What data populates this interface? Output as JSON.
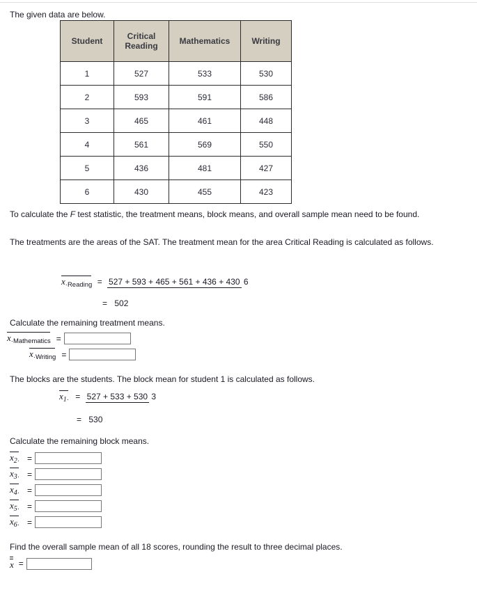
{
  "intro": {
    "text": "The given data are below."
  },
  "table": {
    "headers": [
      "Student",
      "Critical Reading",
      "Mathematics",
      "Writing"
    ],
    "header_lines": [
      [
        "Student"
      ],
      [
        "Critical",
        "Reading"
      ],
      [
        "Mathematics"
      ],
      [
        "Writing"
      ]
    ],
    "rows": [
      {
        "student": "1",
        "critical_reading": "527",
        "mathematics": "533",
        "writing": "530"
      },
      {
        "student": "2",
        "critical_reading": "593",
        "mathematics": "591",
        "writing": "586"
      },
      {
        "student": "3",
        "critical_reading": "465",
        "mathematics": "461",
        "writing": "448"
      },
      {
        "student": "4",
        "critical_reading": "561",
        "mathematics": "569",
        "writing": "550"
      },
      {
        "student": "5",
        "critical_reading": "436",
        "mathematics": "481",
        "writing": "427"
      },
      {
        "student": "6",
        "critical_reading": "430",
        "mathematics": "455",
        "writing": "423"
      }
    ]
  },
  "paragraphs": {
    "f_stat_pre": "To calculate the ",
    "f_stat_italic": "F",
    "f_stat_post": " test statistic, the treatment means, block means, and overall sample mean need to be found.",
    "treatments": "The treatments are the areas of the SAT. The treatment mean for the area Critical Reading is calculated as follows.",
    "calc_treatment_means": "Calculate the remaining treatment means.",
    "blocks": "The blocks are the students. The block mean for student 1 is calculated as follows.",
    "calc_block_means": "Calculate the remaining block means.",
    "overall": "Find the overall sample mean of all 18 scores, rounding the result to three decimal places."
  },
  "treatment_example": {
    "symbol": "x",
    "subscript": "·Reading",
    "equals": "=",
    "numerator": "527 + 593 + 465 + 561 + 436 + 430",
    "denominator": "6",
    "result_equals": "=",
    "result": "502"
  },
  "treatment_inputs": [
    {
      "symbol": "x",
      "subscript": "·Mathematics",
      "equals": "=",
      "value": "",
      "placeholder": ""
    },
    {
      "symbol": "x",
      "subscript": "·Writing",
      "equals": "=",
      "value": "",
      "placeholder": ""
    }
  ],
  "block_example": {
    "symbol": "x",
    "subscript_num": "1",
    "subscript_dot": "·",
    "equals": "=",
    "numerator": "527 + 533 + 530",
    "denominator": "3",
    "result_equals": "=",
    "result": "530"
  },
  "block_inputs": [
    {
      "symbol": "x",
      "subscript_num": "2",
      "subscript_dot": "·",
      "equals": "=",
      "value": "",
      "placeholder": ""
    },
    {
      "symbol": "x",
      "subscript_num": "3",
      "subscript_dot": "·",
      "equals": "=",
      "value": "",
      "placeholder": ""
    },
    {
      "symbol": "x",
      "subscript_num": "4",
      "subscript_dot": "·",
      "equals": "=",
      "value": "",
      "placeholder": ""
    },
    {
      "symbol": "x",
      "subscript_num": "5",
      "subscript_dot": "·",
      "equals": "=",
      "value": "",
      "placeholder": ""
    },
    {
      "symbol": "x",
      "subscript_num": "6",
      "subscript_dot": "·",
      "equals": "=",
      "value": "",
      "placeholder": ""
    }
  ],
  "overall_input": {
    "symbol": "x",
    "equals": "=",
    "value": "",
    "placeholder": ""
  },
  "colors": {
    "table_header_bg": "#d4cfc0",
    "table_border": "#2b2b2b",
    "text": "#1a1a24",
    "input_border": "#767676",
    "rule": "#e2e2e2"
  }
}
